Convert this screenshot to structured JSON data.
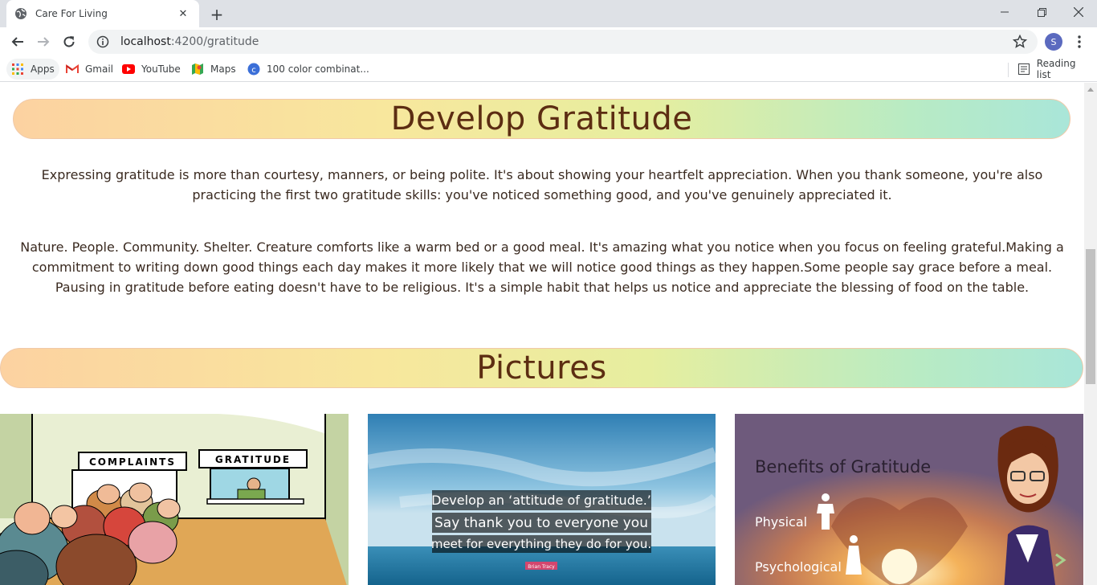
{
  "browser": {
    "tab_title": "Care For Living",
    "url_host": "localhost",
    "url_path": ":4200/gratitude",
    "profile_initial": "S"
  },
  "bookmarks": {
    "items": [
      {
        "label": "Apps",
        "icon": "apps-grid-icon"
      },
      {
        "label": "Gmail",
        "icon": "gmail-icon"
      },
      {
        "label": "YouTube",
        "icon": "youtube-icon"
      },
      {
        "label": "Maps",
        "icon": "maps-icon"
      },
      {
        "label": "100 color combinat...",
        "icon": "color-c-icon"
      }
    ],
    "reading_list": "Reading list"
  },
  "page": {
    "gratitude_heading": "Develop Gratitude",
    "paragraph_1": "Expressing gratitude is more than courtesy, manners, or being polite. It's about showing your heartfelt appreciation. When you thank someone, you're also practicing the first two gratitude skills: you've noticed something good, and you've genuinely appreciated it.",
    "paragraph_2": "Nature. People. Community. Shelter. Creature comforts like a warm bed or a good meal. It's amazing what you notice when you focus on feeling grateful.Making a commitment to writing down good things each day makes it more likely that we will notice good things as they happen.Some people say grace before a meal. Pausing in gratitude before eating doesn't have to be religious. It's a simple habit that helps us notice and appreciate the blessing of food on the table.",
    "pictures_heading": "Pictures",
    "pictures": [
      {
        "sign_left": "COMPLAINTS",
        "sign_right": "GRATITUDE"
      },
      {
        "quote_line_1": "Develop an ‘attitude of gratitude.’",
        "quote_line_2": "Say thank you to everyone you",
        "quote_line_3": "meet for everything they do for you.",
        "author": "Brian Tracy"
      },
      {
        "title": "Benefits of Gratitude",
        "item_1": "Physical",
        "item_2": "Psychological"
      }
    ]
  },
  "colors": {
    "heading_brown": "#5c2d12",
    "banner_gradient": [
      "#fcd2a1",
      "#f8e79d",
      "#b8ebc4",
      "#a9e6d9"
    ]
  }
}
